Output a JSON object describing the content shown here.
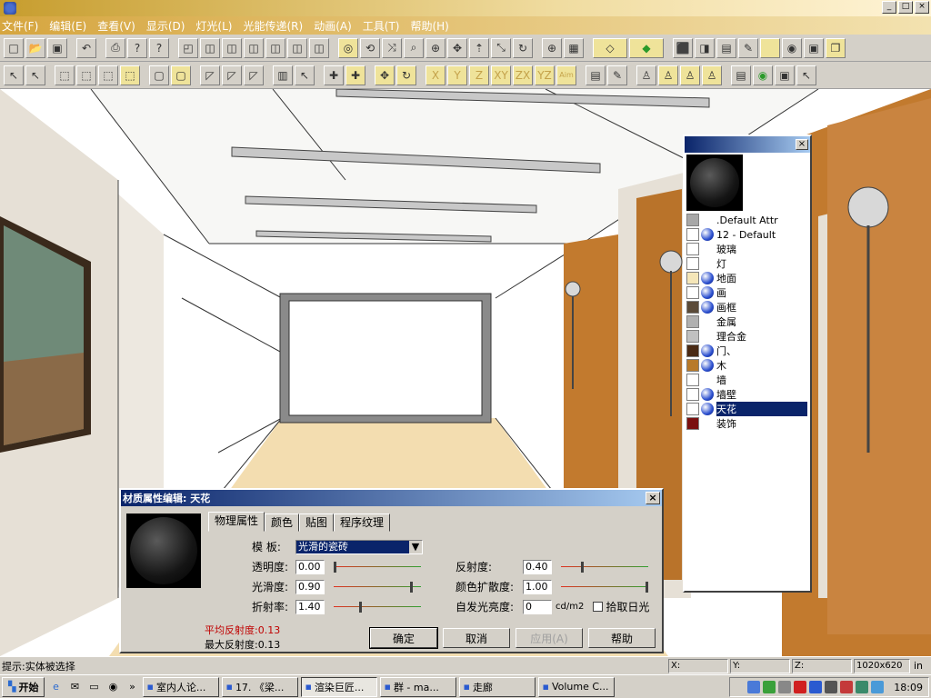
{
  "window": {
    "title": "",
    "min": "_",
    "max": "□",
    "close": "×"
  },
  "menu": [
    "文件(F)",
    "编辑(E)",
    "查看(V)",
    "显示(D)",
    "灯光(L)",
    "光能传递(R)",
    "动画(A)",
    "工具(T)",
    "帮助(H)"
  ],
  "toolbar_axes": [
    "X",
    "Y",
    "Z",
    "XY",
    "ZX",
    "YZ",
    "Aim"
  ],
  "material_panel": {
    "title": "",
    "close": "×",
    "items": [
      {
        "label": ".Default Attr",
        "swatch": "#a8a8a8",
        "globe": false
      },
      {
        "label": "12 - Default",
        "swatch": "#ffffff",
        "globe": true
      },
      {
        "label": "玻璃",
        "swatch": "#ffffff",
        "globe": false
      },
      {
        "label": "灯",
        "swatch": "#ffffff",
        "globe": false
      },
      {
        "label": "地面",
        "swatch": "#f5e6b8",
        "globe": true
      },
      {
        "label": "画",
        "swatch": "#ffffff",
        "globe": true
      },
      {
        "label": "画框",
        "swatch": "#5a4a38",
        "globe": true
      },
      {
        "label": "金属",
        "swatch": "#b0b0b0",
        "globe": false
      },
      {
        "label": "理合金",
        "swatch": "#c0c0c0",
        "globe": false
      },
      {
        "label": "门、",
        "swatch": "#4a2a14",
        "globe": true
      },
      {
        "label": "木",
        "swatch": "#b87a2a",
        "globe": true
      },
      {
        "label": "墙",
        "swatch": "#ffffff",
        "globe": false
      },
      {
        "label": "墙壁",
        "swatch": "#ffffff",
        "globe": true
      },
      {
        "label": "天花",
        "swatch": "#ffffff",
        "globe": true,
        "selected": true
      },
      {
        "label": "装饰",
        "swatch": "#7a1010",
        "globe": false
      }
    ]
  },
  "dialog": {
    "title": "材质属性编辑: 天花",
    "close": "×",
    "tabs": [
      "物理属性",
      "颜色",
      "贴图",
      "程序纹理"
    ],
    "template_label": "模  板:",
    "template_value": "光滑的瓷砖",
    "props": [
      {
        "label": "透明度:",
        "value": "0.00",
        "level": 0.0
      },
      {
        "label": "光滑度:",
        "value": "0.90",
        "level": 0.9
      },
      {
        "label": "折射率:",
        "value": "1.40",
        "level": 0.3
      }
    ],
    "props_right": [
      {
        "label": "反射度:",
        "value": "0.40",
        "level": 0.24
      },
      {
        "label": "颜色扩散度:",
        "value": "1.00",
        "level": 1.0
      }
    ],
    "emissive_label": "自发光亮度:",
    "emissive_value": "0",
    "emissive_unit": "cd/m2",
    "daylight_label": "拾取日光",
    "avg_reflect": "平均反射度:0.13",
    "max_reflect": "最大反射度:0.13",
    "ok": "确定",
    "cancel": "取消",
    "apply": "应用(A)",
    "help": "帮助"
  },
  "status": {
    "hint": "提示:实体被选择",
    "x": "X:",
    "y": "Y:",
    "z": "Z:",
    "res": "1020x620",
    "unit": "in"
  },
  "taskbar": {
    "start": "开始",
    "tasks": [
      "室内人论...",
      "17. 《梁...",
      "渲染巨匠...",
      "群 - ma...",
      "走廊",
      "Volume C..."
    ],
    "active_index": 2,
    "clock": "18:09"
  },
  "colors": {
    "wood": "#c27a2e",
    "selection": "#0a246a",
    "slider_track": "#e03020",
    "slider_track2": "#30a030"
  }
}
